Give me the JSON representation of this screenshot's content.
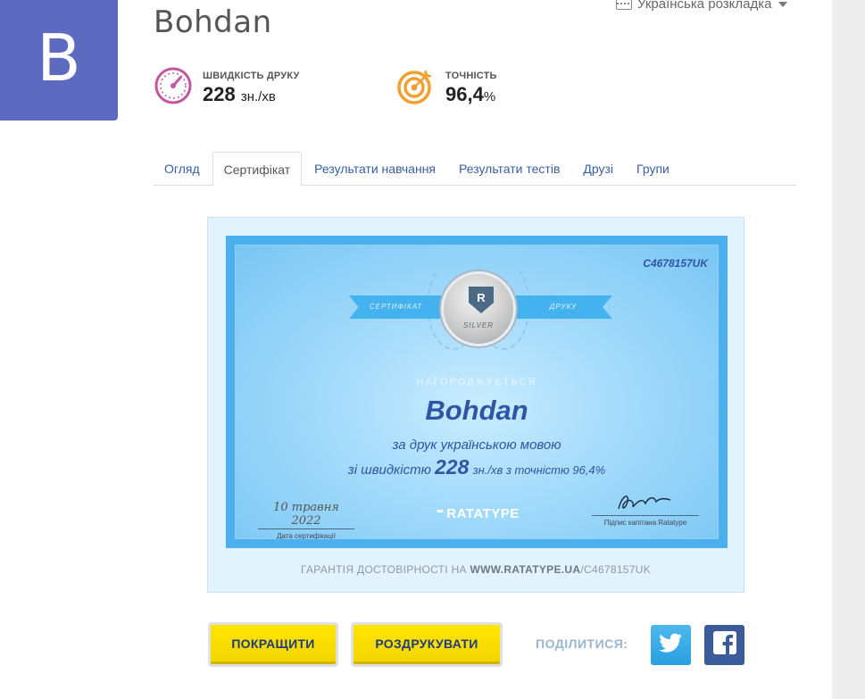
{
  "profile": {
    "avatar_letter": "B",
    "username": "Bohdan",
    "avatar_color": "#5c6bc0"
  },
  "layout_switch": {
    "label": "Українська розкладка",
    "icon": "keyboard-icon"
  },
  "stats": {
    "speed": {
      "label": "ШВИДКІСТЬ ДРУКУ",
      "value": "228",
      "unit": "зн./хв",
      "icon": "speedometer-icon",
      "color": "#c2579e"
    },
    "accuracy": {
      "label": "ТОЧНІСТЬ",
      "value": "96,4",
      "unit": "%",
      "icon": "target-icon",
      "color": "#f0a030"
    }
  },
  "tabs": [
    {
      "label": "Огляд",
      "active": false
    },
    {
      "label": "Сертифікат",
      "active": true
    },
    {
      "label": "Результати навчання",
      "active": false
    },
    {
      "label": "Результати тестів",
      "active": false
    },
    {
      "label": "Друзі",
      "active": false
    },
    {
      "label": "Групи",
      "active": false
    }
  ],
  "certificate": {
    "id": "C4678157UK",
    "ribbon_left": "СЕРТИФІКАТ",
    "ribbon_right": "ДРУКУ",
    "medal_level": "SILVER",
    "medal_mark": "R",
    "awarded": "НАГОРОДЖУЄТЬСЯ",
    "name": "Bohdan",
    "line1": "за друк українською мовою",
    "line2_prefix": "зі швидкістю",
    "line2_speed": "228",
    "line2_suffix": "зн./хв з точністю 96,4%",
    "date": "10 травня 2022",
    "date_caption": "Дата сертифікації",
    "logo": "RATATYPE",
    "signature_caption": "Підпис капітана Ratatype",
    "guarantee_prefix": "ГАРАНТІЯ ДОСТОВІРНОСТІ НА",
    "guarantee_site": "WWW.RATATYPE.UA",
    "guarantee_suffix": "/C4678157UK"
  },
  "actions": {
    "improve": "ПОКРАЩИТИ",
    "print": "РОЗДРУКУВАТИ",
    "share_label": "ПОДІЛИТИСЯ:"
  },
  "social": {
    "twitter_icon": "twitter-icon",
    "facebook_icon": "facebook-icon",
    "twitter_color": "#2a9fe0",
    "facebook_color": "#3b5a9a"
  }
}
